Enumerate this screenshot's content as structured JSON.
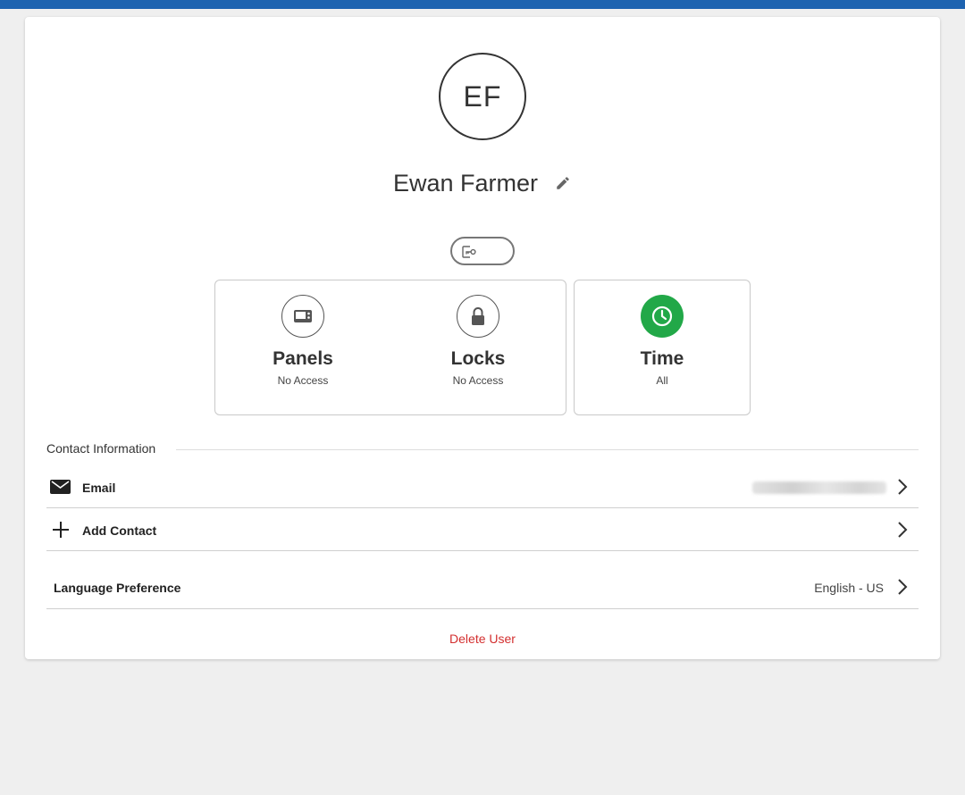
{
  "user": {
    "initials": "EF",
    "name": "Ewan Farmer"
  },
  "icons": {
    "edit": "pencil-icon",
    "badge": "key-card-icon",
    "panels": "panel-icon",
    "locks": "lock-icon",
    "time": "clock-icon",
    "email": "envelope-icon",
    "add_contact": "plus-icon",
    "chevron": "chevron-right-icon"
  },
  "colors": {
    "top_bar": "#1e63b0",
    "time_accent": "#22a848",
    "delete": "#d32f2f"
  },
  "access": {
    "panels": {
      "label": "Panels",
      "status": "No Access"
    },
    "locks": {
      "label": "Locks",
      "status": "No Access"
    },
    "time": {
      "label": "Time",
      "status": "All"
    }
  },
  "contact": {
    "section_title": "Contact Information",
    "email_label": "Email",
    "add_contact_label": "Add Contact"
  },
  "language": {
    "label": "Language Preference",
    "value": "English - US"
  },
  "actions": {
    "delete_user": "Delete User"
  }
}
